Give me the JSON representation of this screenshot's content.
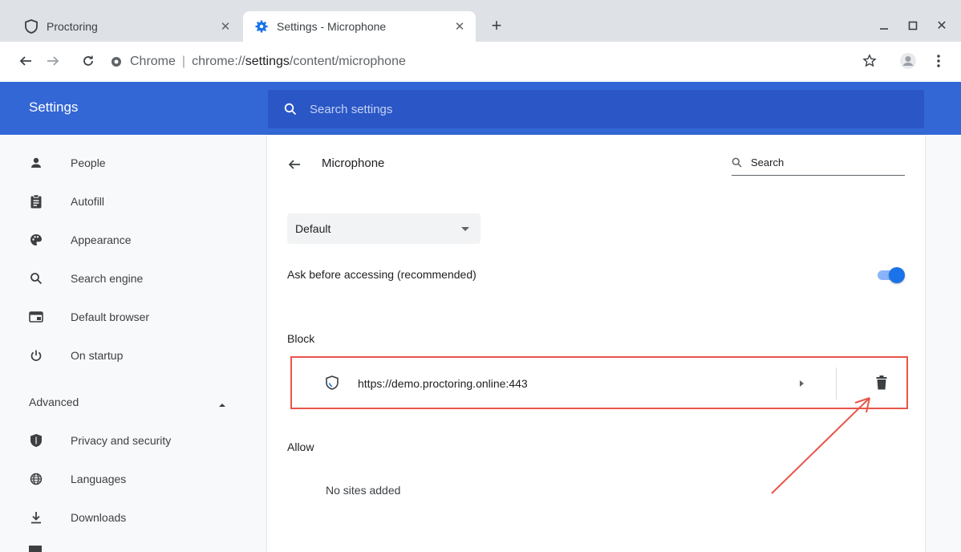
{
  "tabs": [
    {
      "title": "Proctoring",
      "active": false
    },
    {
      "title": "Settings - Microphone",
      "active": true
    }
  ],
  "omnibox": {
    "site_label": "Chrome",
    "url_scheme": "chrome://",
    "url_host": "settings",
    "url_path": "/content/microphone"
  },
  "header": {
    "title": "Settings",
    "search_placeholder": "Search settings"
  },
  "sidebar": {
    "items": [
      {
        "label": "People",
        "icon": "person-icon"
      },
      {
        "label": "Autofill",
        "icon": "clipboard-icon"
      },
      {
        "label": "Appearance",
        "icon": "palette-icon"
      },
      {
        "label": "Search engine",
        "icon": "search-icon"
      },
      {
        "label": "Default browser",
        "icon": "browser-icon"
      },
      {
        "label": "On startup",
        "icon": "power-icon"
      }
    ],
    "advanced_label": "Advanced",
    "advanced_items": [
      {
        "label": "Privacy and security",
        "icon": "shield-icon"
      },
      {
        "label": "Languages",
        "icon": "globe-icon"
      },
      {
        "label": "Downloads",
        "icon": "download-icon"
      }
    ]
  },
  "main": {
    "title": "Microphone",
    "search_label": "Search",
    "device_select": "Default",
    "ask_label": "Ask before accessing (recommended)",
    "ask_enabled": true,
    "block_heading": "Block",
    "blocked_sites": [
      {
        "url": "https://demo.proctoring.online:443"
      }
    ],
    "allow_heading": "Allow",
    "allow_empty": "No sites added"
  },
  "colors": {
    "header_blue": "#3367d6",
    "search_blue": "#2a56c6",
    "toggle_blue": "#1a73e8",
    "annotation_red": "#e8554a"
  }
}
